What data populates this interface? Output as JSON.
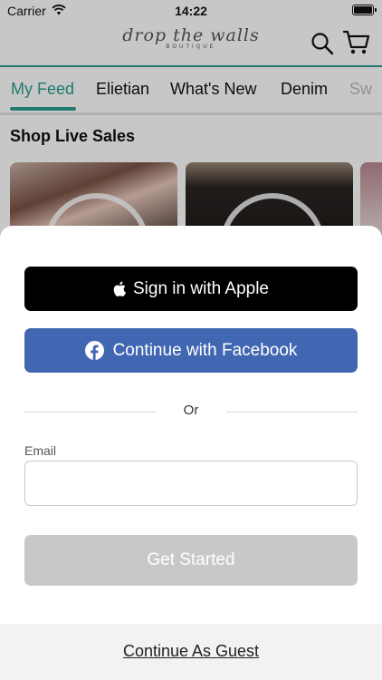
{
  "status_bar": {
    "carrier": "Carrier",
    "time": "14:22"
  },
  "header": {
    "logo_script": "drop the walls",
    "logo_subtitle": "BOUTIQUE",
    "accent_color": "#2a9d8f"
  },
  "tabs": [
    {
      "label": "My Feed",
      "active": true
    },
    {
      "label": "Elietian",
      "active": false
    },
    {
      "label": "What's New",
      "active": false
    },
    {
      "label": "Denim",
      "active": false
    },
    {
      "label": "Sw",
      "active": false
    }
  ],
  "main": {
    "section_title": "Shop Live Sales"
  },
  "sign_in_sheet": {
    "apple_button": "Sign in with Apple",
    "facebook_button": "Continue with Facebook",
    "facebook_color": "#4267b2",
    "divider_text": "Or",
    "email_label": "Email",
    "email_value": "",
    "get_started_button": "Get Started",
    "guest_link": "Continue As Guest"
  }
}
